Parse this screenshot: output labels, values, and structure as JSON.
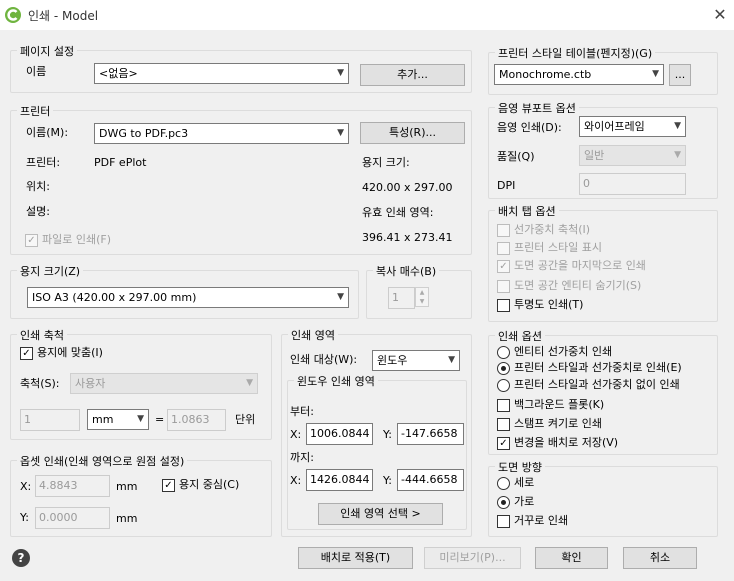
{
  "window": {
    "title": "인쇄 - Model",
    "app_icon": "app-logo-icon",
    "close_icon": "close-icon"
  },
  "page_setup": {
    "legend": "페이지 설정",
    "name_label": "이름",
    "name_value": "<없음>",
    "add_button": "추가..."
  },
  "printer": {
    "legend": "프린터",
    "name_label": "이름(M):",
    "name_value": "DWG to PDF.pc3",
    "properties_button": "특성(R)...",
    "printer_label": "프린터:",
    "printer_value": "PDF ePlot",
    "location_label": "위치:",
    "description_label": "설명:",
    "plot_to_file": "파일로 인쇄(F)",
    "paper_size_label": "용지 크기:",
    "paper_size_value": "420.00 x 297.00",
    "printable_area_label": "유효 인쇄 영역:",
    "printable_area_value": "396.41 x 273.41"
  },
  "paper_size": {
    "legend": "용지 크기(Z)",
    "value": "ISO A3 (420.00 x 297.00 mm)"
  },
  "copies": {
    "legend": "복사 매수(B)",
    "value": "1"
  },
  "plot_scale": {
    "legend": "인쇄 축척",
    "fit_to_paper": "용지에 맞춤(I)",
    "scale_label": "축척(S):",
    "scale_value": "사용자",
    "value1": "1",
    "unit": "mm",
    "equals": "=",
    "value2": "1.0863",
    "unit_label": "단위"
  },
  "plot_offset": {
    "legend": "옵셋 인쇄(인쇄 영역으로 원점 설정)",
    "x_label": "X:",
    "x_value": "4.8843",
    "x_unit": "mm",
    "y_label": "Y:",
    "y_value": "0.0000",
    "y_unit": "mm",
    "center_plot": "용지 중심(C)"
  },
  "plot_area": {
    "legend": "인쇄 영역",
    "what_label": "인쇄 대상(W):",
    "what_value": "윈도우",
    "window_legend": "윈도우 인쇄 영역",
    "from_label": "부터:",
    "from_x_label": "X:",
    "from_x": "1006.0844",
    "from_y_label": "Y:",
    "from_y": "-147.6658",
    "to_label": "까지:",
    "to_x_label": "X:",
    "to_x": "1426.0844",
    "to_y_label": "Y:",
    "to_y": "-444.6658",
    "select_button": "인쇄 영역 선택 >"
  },
  "plot_style": {
    "legend": "프린터 스타일 테이블(펜지정)(G)",
    "value": "Monochrome.ctb",
    "edit_button": "..."
  },
  "shaded_viewport": {
    "legend": "음영 뷰포트 옵션",
    "shade_label": "음영 인쇄(D):",
    "shade_value": "와이어프레임",
    "quality_label": "품질(Q)",
    "quality_value": "일반",
    "dpi_label": "DPI",
    "dpi_value": "0"
  },
  "layout_options": {
    "legend": "배치 탭 옵션",
    "items": [
      {
        "label": "선가중치 축척(I)",
        "state": "disabled"
      },
      {
        "label": "프린터 스타일 표시",
        "state": "disabled"
      },
      {
        "label": "도면 공간을 마지막으로 인쇄",
        "state": "disabled-checked"
      },
      {
        "label": "도면 공간 엔티티 숨기기(S)",
        "state": "disabled"
      },
      {
        "label": "투명도 인쇄(T)",
        "state": "unchecked"
      }
    ]
  },
  "plot_options": {
    "legend": "인쇄 옵션",
    "radios": [
      {
        "label": "엔티티 선가중치 인쇄",
        "selected": false
      },
      {
        "label": "프린터 스타일과 선가중치로 인쇄(E)",
        "selected": true
      },
      {
        "label": "프린터 스타일과 선가중치 없이 인쇄",
        "selected": false
      }
    ],
    "checks": [
      {
        "label": "백그라운드 플롯(K)",
        "checked": false
      },
      {
        "label": "스탬프 켜기로 인쇄",
        "checked": false
      },
      {
        "label": "변경을 배치로 저장(V)",
        "checked": true
      }
    ]
  },
  "orientation": {
    "legend": "도면 방향",
    "portrait": "세로",
    "landscape": "가로",
    "upside_down": "거꾸로 인쇄",
    "selected": "landscape"
  },
  "footer": {
    "help_icon": "?",
    "apply_layout": "배치로 적용(T)",
    "preview": "미리보기(P)...",
    "ok": "확인",
    "cancel": "취소"
  }
}
